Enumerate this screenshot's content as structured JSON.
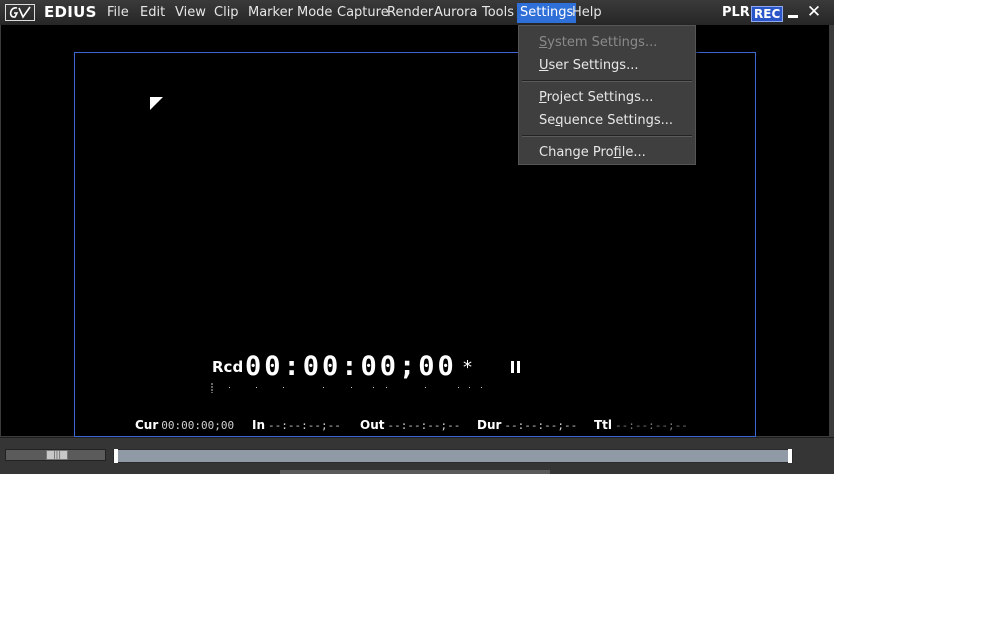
{
  "app": {
    "title": "EDIUS"
  },
  "menubar": {
    "items": [
      "File",
      "Edit",
      "View",
      "Clip",
      "Marker",
      "Mode",
      "Capture",
      "Render",
      "Aurora",
      "Tools",
      "Settings",
      "Help"
    ],
    "active": "Settings"
  },
  "mode": {
    "plr": "PLR",
    "rec": "REC"
  },
  "settings_menu": {
    "items": [
      {
        "pre": "",
        "ul": "S",
        "post": "ystem Settings...",
        "enabled": false
      },
      {
        "pre": "",
        "ul": "U",
        "post": "ser Settings...",
        "enabled": true
      },
      {
        "pre": "",
        "ul": "P",
        "post": "roject Settings...",
        "enabled": true
      },
      {
        "pre": "Se",
        "ul": "q",
        "post": "uence Settings...",
        "enabled": true
      },
      {
        "pre": "Change Pro",
        "ul": "f",
        "post": "ile...",
        "enabled": true
      }
    ]
  },
  "viewer": {
    "tc_label": "Rcd",
    "tc_value": "00:00:00;00",
    "tc_star": "*"
  },
  "info": {
    "cur_label": "Cur",
    "cur_value": "00:00:00;00",
    "in_label": "In",
    "in_value": "--:--:--;--",
    "out_label": "Out",
    "out_value": "--:--:--;--",
    "dur_label": "Dur",
    "dur_value": "--:--:--;--",
    "ttl_label": "Ttl",
    "ttl_value": "--:--:--;--"
  },
  "colors": {
    "accent": "#2e6fd8",
    "frame": "#3d65d4",
    "rec_bg": "#2b56c8"
  },
  "icons": [
    "grass-valley-logo-icon",
    "minimize-icon",
    "close-icon",
    "pause-icon",
    "corner-marker-icon"
  ]
}
